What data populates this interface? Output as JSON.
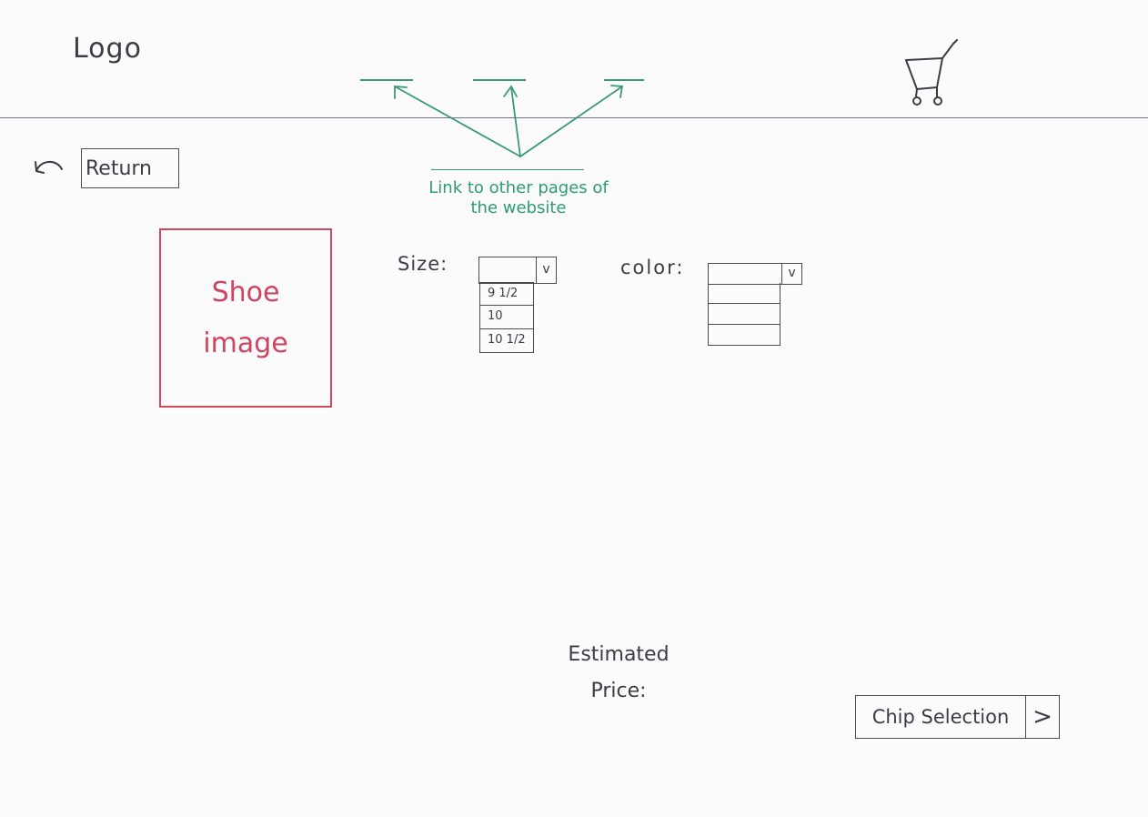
{
  "header": {
    "logo_text": "Logo",
    "nav_annotation": "Link to other pages of the website",
    "cart_icon": "cart-icon"
  },
  "return": {
    "label": "Return",
    "icon": "return-arrow-icon"
  },
  "product": {
    "image_label_line1": "Shoe",
    "image_label_line2": "image",
    "size_label": "Size:",
    "size_dropdown_chevron": "v",
    "size_options": [
      "9 1/2",
      "10",
      "10 1/2"
    ],
    "color_label": "color:",
    "color_dropdown_chevron": "v"
  },
  "price": {
    "line1": "Estimated",
    "line2": "Price:"
  },
  "footer": {
    "checkout_label": "Chip Selection",
    "checkout_arrow": ">"
  },
  "colors": {
    "annotation": "#2f9a78",
    "image_placeholder": "#d4455e",
    "ink": "#3c3c44",
    "header_line": "#6f7384"
  }
}
